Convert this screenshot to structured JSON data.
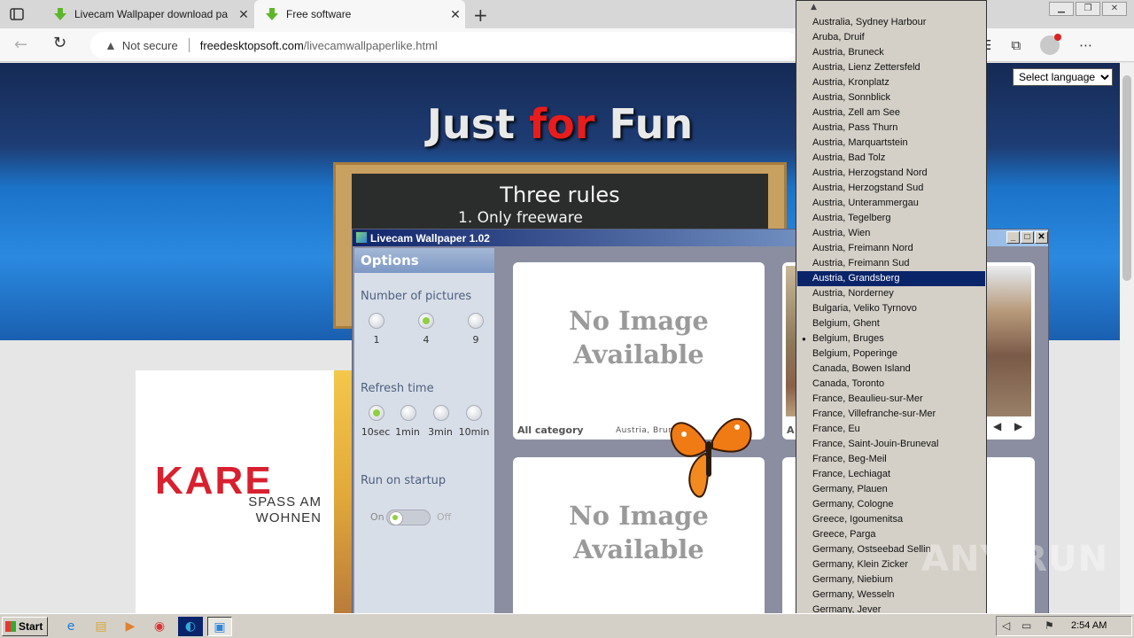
{
  "browser": {
    "tabs": [
      {
        "title": "Livecam Wallpaper download pa",
        "active": false
      },
      {
        "title": "Free software",
        "active": true
      }
    ],
    "url_security": "Not secure",
    "url_domain": "freedesktopsoft.com",
    "url_path": "/livecamwallpaperlike.html"
  },
  "webpage": {
    "hero_title_1": "Just ",
    "hero_title_2": "for",
    "hero_title_3": " Fun",
    "board_heading": "Three rules",
    "board_rule_1": "1. Only freeware",
    "language_select": "Select language",
    "ad_brand": "KARE",
    "ad_tagline_1": "SPASS AM",
    "ad_tagline_2": "WOHNEN"
  },
  "app": {
    "title": "Livecam Wallpaper 1.02",
    "options_heading": "Options",
    "num_pictures_label": "Number of pictures",
    "num_pictures_options": [
      "1",
      "4",
      "9"
    ],
    "num_pictures_selected": "4",
    "refresh_label": "Refresh time",
    "refresh_options": [
      "10sec",
      "1min",
      "3min",
      "10min"
    ],
    "refresh_selected": "10sec",
    "startup_label": "Run on startup",
    "startup_on": "On",
    "startup_off": "Off",
    "no_image_1": "No Image",
    "no_image_2": "Available",
    "card_category": "All category",
    "card_city": "Austria, Bruneck",
    "card2_category_partial": "A"
  },
  "dropdown": {
    "items": [
      "Australia, Sydney Harbour",
      "Aruba, Druif",
      "Austria, Bruneck",
      "Austria, Lienz Zettersfeld",
      "Austria, Kronplatz",
      "Austria, Sonnblick",
      "Austria, Zell am See",
      "Austria, Pass Thurn",
      "Austria, Marquartstein",
      "Austria, Bad Tolz",
      "Austria, Herzogstand Nord",
      "Austria, Herzogstand Sud",
      "Austria, Unterammergau",
      "Austria, Tegelberg",
      "Austria, Wien",
      "Austria, Freimann Nord",
      "Austria, Freimann Sud",
      "Austria, Grandsberg",
      "Austria, Norderney",
      "Bulgaria, Veliko Tyrnovo",
      "Belgium, Ghent",
      "Belgium, Bruges",
      "Belgium, Poperinge",
      "Canada, Bowen Island",
      "Canada, Toronto",
      "France, Beaulieu-sur-Mer",
      "France, Villefranche-sur-Mer",
      "France, Eu",
      "France, Saint-Jouin-Bruneval",
      "France, Beg-Meil",
      "France, Lechiagat",
      "Germany, Plauen",
      "Germany, Cologne",
      "Greece, Igoumenitsa",
      "Greece, Parga",
      "Germany, Ostseebad Sellin",
      "Germany, Klein Zicker",
      "Germany, Niebium",
      "Germany, Wesseln",
      "Germany, Jever"
    ],
    "highlighted": "Austria, Grandsberg",
    "checked": "Belgium, Bruges"
  },
  "taskbar": {
    "start_label": "Start",
    "clock": "2:54 AM"
  },
  "watermark": "ANY RUN",
  "colors": {
    "accent": "#0a246a",
    "hero_red": "#e81c1c",
    "kare_red": "#d8202e"
  }
}
